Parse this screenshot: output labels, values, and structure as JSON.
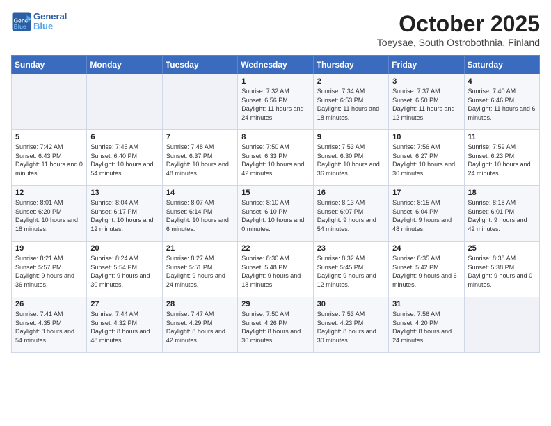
{
  "header": {
    "logo_line1": "General",
    "logo_line2": "Blue",
    "month_title": "October 2025",
    "subtitle": "Toeysae, South Ostrobothnia, Finland"
  },
  "days_of_week": [
    "Sunday",
    "Monday",
    "Tuesday",
    "Wednesday",
    "Thursday",
    "Friday",
    "Saturday"
  ],
  "weeks": [
    [
      {
        "day": "",
        "info": ""
      },
      {
        "day": "",
        "info": ""
      },
      {
        "day": "",
        "info": ""
      },
      {
        "day": "1",
        "info": "Sunrise: 7:32 AM\nSunset: 6:56 PM\nDaylight: 11 hours and 24 minutes."
      },
      {
        "day": "2",
        "info": "Sunrise: 7:34 AM\nSunset: 6:53 PM\nDaylight: 11 hours and 18 minutes."
      },
      {
        "day": "3",
        "info": "Sunrise: 7:37 AM\nSunset: 6:50 PM\nDaylight: 11 hours and 12 minutes."
      },
      {
        "day": "4",
        "info": "Sunrise: 7:40 AM\nSunset: 6:46 PM\nDaylight: 11 hours and 6 minutes."
      }
    ],
    [
      {
        "day": "5",
        "info": "Sunrise: 7:42 AM\nSunset: 6:43 PM\nDaylight: 11 hours and 0 minutes."
      },
      {
        "day": "6",
        "info": "Sunrise: 7:45 AM\nSunset: 6:40 PM\nDaylight: 10 hours and 54 minutes."
      },
      {
        "day": "7",
        "info": "Sunrise: 7:48 AM\nSunset: 6:37 PM\nDaylight: 10 hours and 48 minutes."
      },
      {
        "day": "8",
        "info": "Sunrise: 7:50 AM\nSunset: 6:33 PM\nDaylight: 10 hours and 42 minutes."
      },
      {
        "day": "9",
        "info": "Sunrise: 7:53 AM\nSunset: 6:30 PM\nDaylight: 10 hours and 36 minutes."
      },
      {
        "day": "10",
        "info": "Sunrise: 7:56 AM\nSunset: 6:27 PM\nDaylight: 10 hours and 30 minutes."
      },
      {
        "day": "11",
        "info": "Sunrise: 7:59 AM\nSunset: 6:23 PM\nDaylight: 10 hours and 24 minutes."
      }
    ],
    [
      {
        "day": "12",
        "info": "Sunrise: 8:01 AM\nSunset: 6:20 PM\nDaylight: 10 hours and 18 minutes."
      },
      {
        "day": "13",
        "info": "Sunrise: 8:04 AM\nSunset: 6:17 PM\nDaylight: 10 hours and 12 minutes."
      },
      {
        "day": "14",
        "info": "Sunrise: 8:07 AM\nSunset: 6:14 PM\nDaylight: 10 hours and 6 minutes."
      },
      {
        "day": "15",
        "info": "Sunrise: 8:10 AM\nSunset: 6:10 PM\nDaylight: 10 hours and 0 minutes."
      },
      {
        "day": "16",
        "info": "Sunrise: 8:13 AM\nSunset: 6:07 PM\nDaylight: 9 hours and 54 minutes."
      },
      {
        "day": "17",
        "info": "Sunrise: 8:15 AM\nSunset: 6:04 PM\nDaylight: 9 hours and 48 minutes."
      },
      {
        "day": "18",
        "info": "Sunrise: 8:18 AM\nSunset: 6:01 PM\nDaylight: 9 hours and 42 minutes."
      }
    ],
    [
      {
        "day": "19",
        "info": "Sunrise: 8:21 AM\nSunset: 5:57 PM\nDaylight: 9 hours and 36 minutes."
      },
      {
        "day": "20",
        "info": "Sunrise: 8:24 AM\nSunset: 5:54 PM\nDaylight: 9 hours and 30 minutes."
      },
      {
        "day": "21",
        "info": "Sunrise: 8:27 AM\nSunset: 5:51 PM\nDaylight: 9 hours and 24 minutes."
      },
      {
        "day": "22",
        "info": "Sunrise: 8:30 AM\nSunset: 5:48 PM\nDaylight: 9 hours and 18 minutes."
      },
      {
        "day": "23",
        "info": "Sunrise: 8:32 AM\nSunset: 5:45 PM\nDaylight: 9 hours and 12 minutes."
      },
      {
        "day": "24",
        "info": "Sunrise: 8:35 AM\nSunset: 5:42 PM\nDaylight: 9 hours and 6 minutes."
      },
      {
        "day": "25",
        "info": "Sunrise: 8:38 AM\nSunset: 5:38 PM\nDaylight: 9 hours and 0 minutes."
      }
    ],
    [
      {
        "day": "26",
        "info": "Sunrise: 7:41 AM\nSunset: 4:35 PM\nDaylight: 8 hours and 54 minutes."
      },
      {
        "day": "27",
        "info": "Sunrise: 7:44 AM\nSunset: 4:32 PM\nDaylight: 8 hours and 48 minutes."
      },
      {
        "day": "28",
        "info": "Sunrise: 7:47 AM\nSunset: 4:29 PM\nDaylight: 8 hours and 42 minutes."
      },
      {
        "day": "29",
        "info": "Sunrise: 7:50 AM\nSunset: 4:26 PM\nDaylight: 8 hours and 36 minutes."
      },
      {
        "day": "30",
        "info": "Sunrise: 7:53 AM\nSunset: 4:23 PM\nDaylight: 8 hours and 30 minutes."
      },
      {
        "day": "31",
        "info": "Sunrise: 7:56 AM\nSunset: 4:20 PM\nDaylight: 8 hours and 24 minutes."
      },
      {
        "day": "",
        "info": ""
      }
    ]
  ]
}
